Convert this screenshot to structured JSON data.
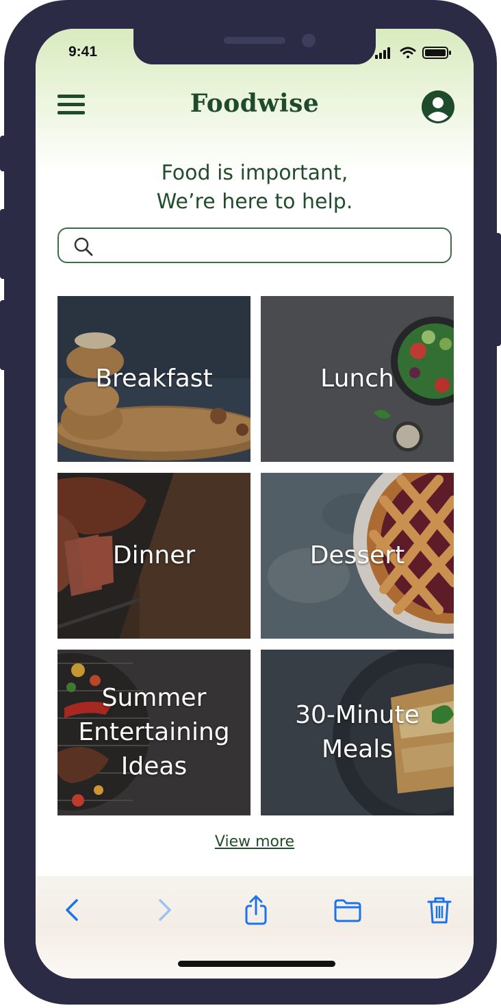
{
  "status_bar": {
    "time": "9:41"
  },
  "header": {
    "app_title": "Foodwise"
  },
  "tagline": "Food is important,\nWe’re here to help.",
  "search": {
    "value": "",
    "placeholder": ""
  },
  "categories": [
    {
      "label": "Breakfast"
    },
    {
      "label": "Lunch"
    },
    {
      "label": "Dinner"
    },
    {
      "label": "Dessert"
    },
    {
      "label": "Summer\nEntertaining\nIdeas"
    },
    {
      "label": "30-Minute\nMeals"
    }
  ],
  "view_more_label": "View more",
  "colors": {
    "brand_green": "#1f4a2b",
    "frame": "#2b2b45",
    "toolbar_blue": "#1a73e8"
  },
  "toolbar_icons": [
    "back-icon",
    "forward-icon",
    "share-icon",
    "folder-icon",
    "trash-icon"
  ]
}
